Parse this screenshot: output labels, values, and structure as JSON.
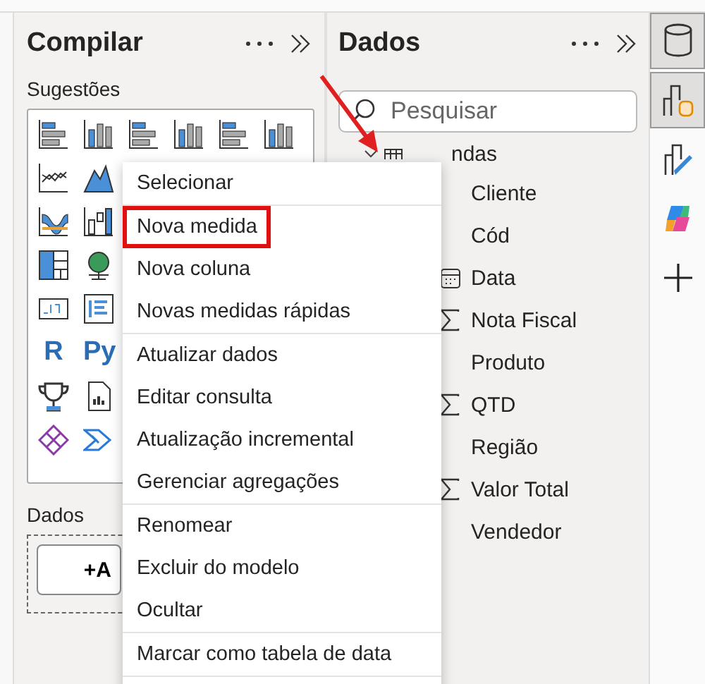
{
  "build_pane": {
    "title": "Compilar",
    "suggestions_label": "Sugestões",
    "visuals": [
      {
        "kind": "hbar"
      },
      {
        "kind": "cbar"
      },
      {
        "kind": "hbar2"
      },
      {
        "kind": "cbar2"
      },
      {
        "kind": "hbar3"
      },
      {
        "kind": "cbar3"
      },
      {
        "kind": "line"
      },
      {
        "kind": "area"
      },
      {
        "kind": "ribbon"
      },
      {
        "kind": "waterfall"
      },
      {
        "kind": "treemap"
      },
      {
        "kind": "globe"
      },
      {
        "kind": "card"
      },
      {
        "kind": "list"
      },
      {
        "kind": "text",
        "text": "R"
      },
      {
        "kind": "text",
        "text": "Py"
      },
      {
        "kind": "trophy"
      },
      {
        "kind": "report"
      },
      {
        "kind": "diamond"
      },
      {
        "kind": "chevron"
      }
    ],
    "data_label": "Dados",
    "add_button": "+A"
  },
  "data_pane": {
    "title": "Dados",
    "search": {
      "placeholder": "Pesquisar"
    },
    "table": {
      "name": "ndas",
      "expanded": true,
      "fields": [
        {
          "name": "Cliente",
          "kind": "text"
        },
        {
          "name": "Cód",
          "kind": "text"
        },
        {
          "name": "Data",
          "kind": "date"
        },
        {
          "name": "Nota Fiscal",
          "kind": "sum"
        },
        {
          "name": "Produto",
          "kind": "text"
        },
        {
          "name": "QTD",
          "kind": "sum"
        },
        {
          "name": "Região",
          "kind": "text"
        },
        {
          "name": "Valor Total",
          "kind": "sum"
        },
        {
          "name": "Vendedor",
          "kind": "text"
        }
      ]
    }
  },
  "rail": [
    {
      "kind": "data",
      "selected": true
    },
    {
      "kind": "model",
      "selected": true
    },
    {
      "kind": "format",
      "selected": false
    },
    {
      "kind": "copilot",
      "selected": false
    },
    {
      "kind": "add",
      "selected": false
    }
  ],
  "context_menu": {
    "groups": [
      [
        {
          "label": "Selecionar",
          "highlighted": false
        }
      ],
      [
        {
          "label": "Nova medida",
          "highlighted": true
        },
        {
          "label": "Nova coluna",
          "highlighted": false
        },
        {
          "label": "Novas medidas rápidas",
          "highlighted": false
        }
      ],
      [
        {
          "label": "Atualizar dados",
          "highlighted": false
        },
        {
          "label": "Editar consulta",
          "highlighted": false
        },
        {
          "label": "Atualização incremental",
          "highlighted": false
        },
        {
          "label": "Gerenciar agregações",
          "highlighted": false
        }
      ],
      [
        {
          "label": "Renomear",
          "highlighted": false
        },
        {
          "label": "Excluir do modelo",
          "highlighted": false
        },
        {
          "label": "Ocultar",
          "highlighted": false
        }
      ],
      [
        {
          "label": "Marcar como tabela de data",
          "highlighted": false
        }
      ]
    ]
  }
}
